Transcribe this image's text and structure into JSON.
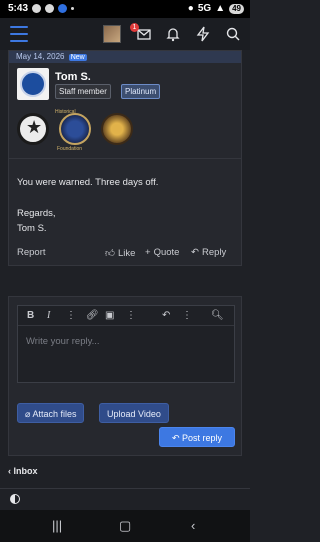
{
  "status_bar": {
    "time": "5:43",
    "network": "5G",
    "battery": "49"
  },
  "app_bar": {
    "notification_count": "1"
  },
  "post": {
    "date": "May 14, 2026",
    "new_badge": "New",
    "author": "Tom S.",
    "tags": [
      "Staff member",
      "Platinum"
    ],
    "trophy_text_top": "Historical",
    "trophy_text_bottom": "Foundation",
    "message_lines": [
      "You were warned. Three days off.",
      "Regards,",
      "Tom S."
    ],
    "actions": {
      "report": "Report",
      "like": "Like",
      "quote": "Quote",
      "reply": "Reply"
    }
  },
  "editor": {
    "placeholder": "Write your reply...",
    "attach_label": "Attach files",
    "upload_label": "Upload Video",
    "post_label": "Post reply"
  },
  "footer": {
    "inbox_label": "Inbox"
  }
}
